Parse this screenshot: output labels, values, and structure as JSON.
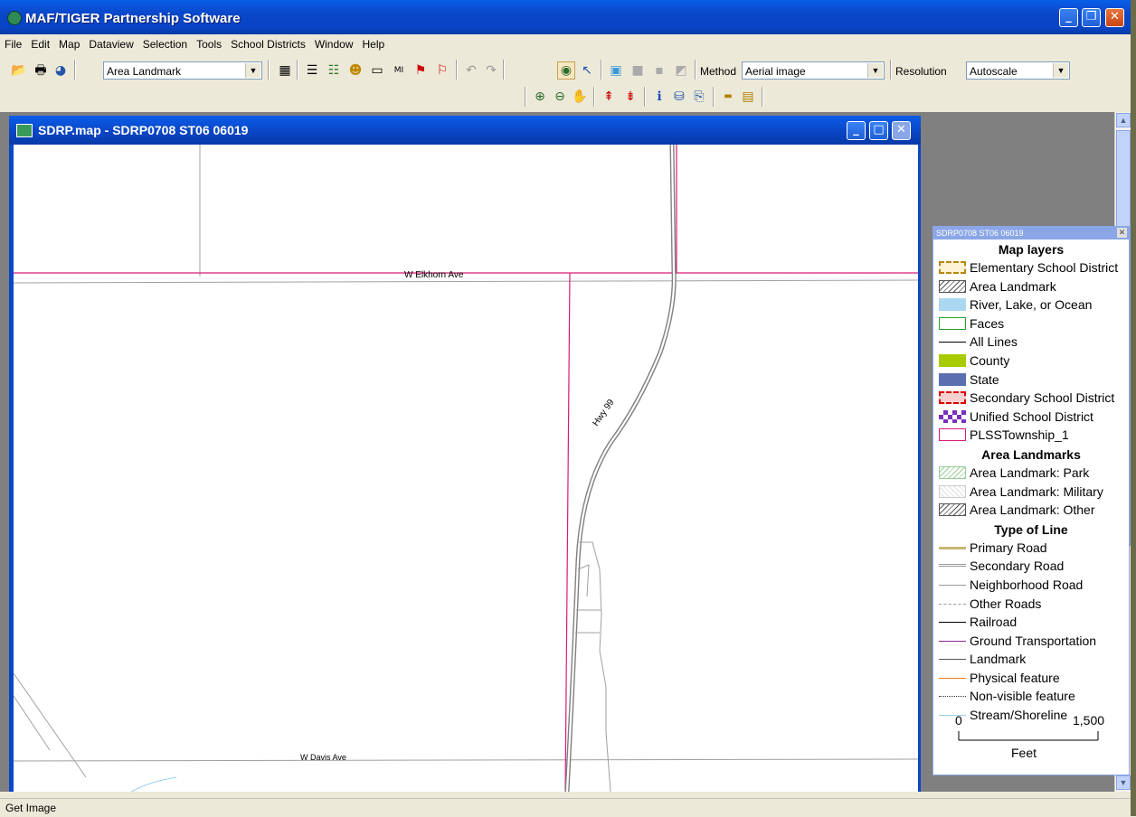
{
  "app": {
    "title": "MAF/TIGER Partnership Software"
  },
  "menu": [
    "File",
    "Edit",
    "Map",
    "Dataview",
    "Selection",
    "Tools",
    "School Districts",
    "Window",
    "Help"
  ],
  "toolbar": {
    "layer_combo": "Area Landmark",
    "method_label": "Method",
    "method_value": "Aerial image",
    "resolution_label": "Resolution",
    "resolution_value": "Autoscale"
  },
  "child_window": {
    "title": "SDRP.map - SDRP0708 ST06 06019"
  },
  "map_labels": {
    "road1": "W Elkhorn Ave",
    "road2": "Hwy 99",
    "road3": "W Davis Ave"
  },
  "legend": {
    "header": "SDRP0708 ST06 06019",
    "sections": [
      {
        "title": "Map layers",
        "items": [
          {
            "label": "Elementary School District",
            "swatch": "elem"
          },
          {
            "label": "Area Landmark",
            "swatch": "hatch"
          },
          {
            "label": "River, Lake, or Ocean",
            "swatch": "water"
          },
          {
            "label": "Faces",
            "swatch": "faces"
          },
          {
            "label": "All Lines",
            "swatch": "line-black"
          },
          {
            "label": "County",
            "swatch": "county"
          },
          {
            "label": "State",
            "swatch": "state"
          },
          {
            "label": "Secondary School District",
            "swatch": "secondary"
          },
          {
            "label": "Unified School District",
            "swatch": "unified"
          },
          {
            "label": "PLSSTownship_1",
            "swatch": "plss"
          }
        ]
      },
      {
        "title": "Area Landmarks",
        "items": [
          {
            "label": "Area Landmark: Park",
            "swatch": "park"
          },
          {
            "label": "Area Landmark: Military",
            "swatch": "military"
          },
          {
            "label": "Area Landmark: Other",
            "swatch": "hatch"
          }
        ]
      },
      {
        "title": "Type of Line",
        "items": [
          {
            "label": "Primary Road",
            "swatch": "primary"
          },
          {
            "label": "Secondary Road",
            "swatch": "secondaryroad"
          },
          {
            "label": "Neighborhood Road",
            "swatch": "neighborhood"
          },
          {
            "label": "Other Roads",
            "swatch": "other"
          },
          {
            "label": "Railroad",
            "swatch": "railroad"
          },
          {
            "label": "Ground Transportation",
            "swatch": "ground"
          },
          {
            "label": "Landmark",
            "swatch": "landmark"
          },
          {
            "label": "Physical feature",
            "swatch": "physical"
          },
          {
            "label": "Non-visible feature",
            "swatch": "nonvisible"
          },
          {
            "label": "Stream/Shoreline",
            "swatch": "stream"
          }
        ]
      }
    ],
    "scale": {
      "min": "0",
      "max": "1,500",
      "unit": "Feet"
    }
  },
  "colors": {
    "title_blue": "#0a47c8",
    "plss_magenta": "#d81b78",
    "county": "#a6cc00",
    "state": "#5b6fb0",
    "unified": "#7a2fbf"
  },
  "status": {
    "text": "Get Image"
  }
}
